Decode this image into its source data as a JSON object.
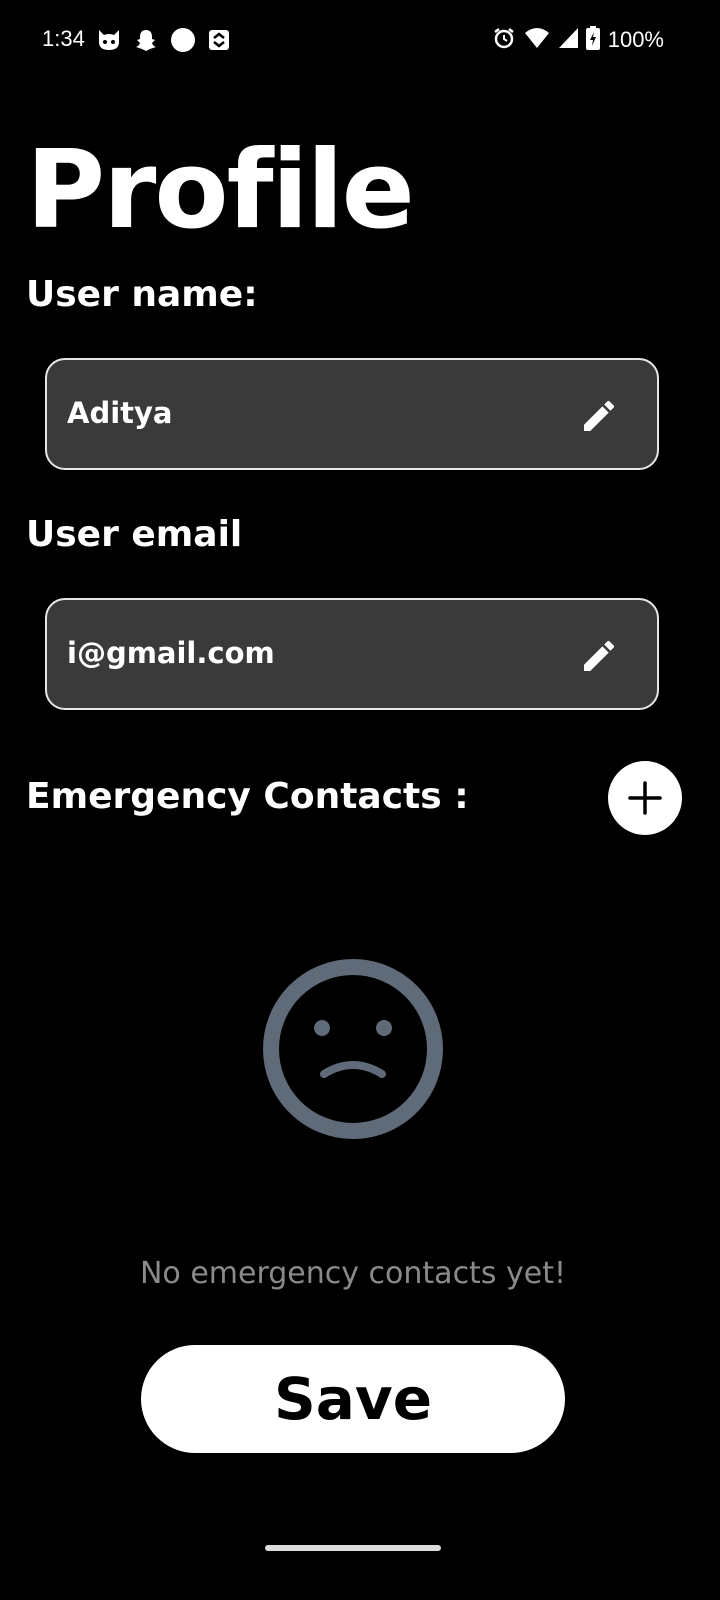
{
  "status_bar": {
    "time": "1:34",
    "battery": "100%",
    "left_icons": [
      "cat-app-icon",
      "snapchat-icon",
      "circle-icon",
      "sync-icon"
    ],
    "right_icons": [
      "alarm-icon",
      "wifi-icon",
      "signal-icon",
      "battery-icon"
    ]
  },
  "page": {
    "title": "Profile"
  },
  "username": {
    "label": "User name:",
    "value": "Aditya"
  },
  "email": {
    "label": "User email",
    "value": "i@gmail.com"
  },
  "contacts": {
    "label": "Emergency Contacts :",
    "empty_text": "No emergency contacts yet!"
  },
  "actions": {
    "save_label": "Save"
  },
  "colors": {
    "background": "#000000",
    "field_background": "#3a3a3a",
    "field_border": "#e6e6e6",
    "muted_text": "#8a8a8a",
    "empty_icon": "#5f6b78"
  }
}
